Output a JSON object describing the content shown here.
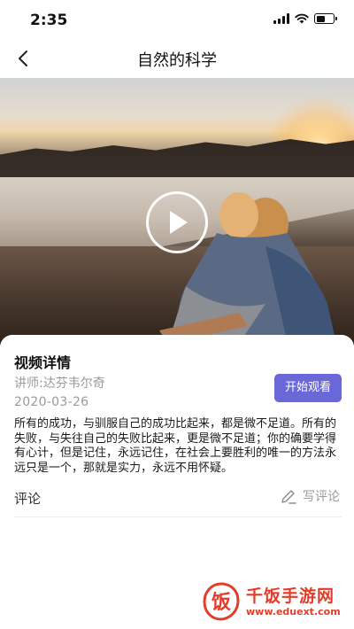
{
  "status_bar": {
    "time": "2:35"
  },
  "nav": {
    "title": "自然的科学"
  },
  "video": {
    "play_icon": "play-icon"
  },
  "detail": {
    "section_title": "视频详情",
    "lecturer": "讲师:达芬韦尔奇",
    "date": "2020-03-26",
    "watch_button": "开始观看",
    "description": "所有的成功，与驯服自己的成功比起来，都是微不足道。所有的失败，与失往自己的失败比起来，更是微不足道；你的确要学得有心计，但是记住，永远记住，在社会上要胜利的唯一的方法永远只是一个，那就是实力，永远不用怀疑。"
  },
  "comments": {
    "label": "评论",
    "write_label": "写评论"
  },
  "watermark": {
    "logo_text": "饭",
    "name": "千饭手游网",
    "url": "www.eduext.com"
  },
  "colors": {
    "accent": "#6a68d8",
    "watermark": "#e23d2a"
  }
}
